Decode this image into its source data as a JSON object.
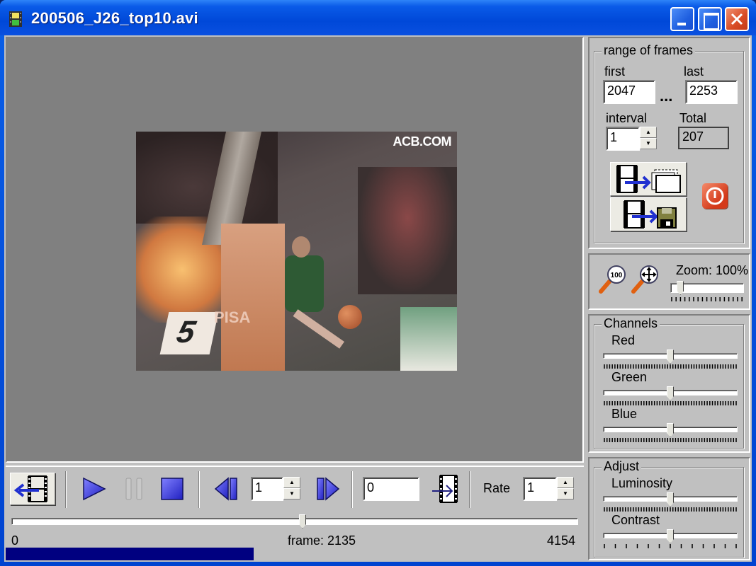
{
  "window": {
    "title": "200506_J26_top10.avi",
    "app_icon": "film-icon",
    "controls": [
      "minimize",
      "maximize",
      "close"
    ]
  },
  "video": {
    "watermark": "ACB.COM",
    "overlay_number": "5",
    "sponsor_text": "PISA"
  },
  "playback": {
    "back_button": "film-back-icon",
    "play": "play-icon",
    "pause": "pause-icon",
    "stop": "stop-icon",
    "prev_frame": "step-back-icon",
    "step_value": "1",
    "next_frame": "step-forward-icon",
    "goto_frame_value": "0",
    "goto_button": "goto-frame-icon",
    "rate_label": "Rate",
    "rate_value": "1"
  },
  "timeline": {
    "min_label": "0",
    "max_label": "4154",
    "frame_label": "frame: 2135",
    "current_frame": 2135,
    "total_frames": 4154,
    "progress_fraction": 0.43
  },
  "range": {
    "legend": "range of frames",
    "first_label": "first",
    "first_value": "2047",
    "last_label": "last",
    "last_value": "2253",
    "separator": "...",
    "interval_label": "interval",
    "interval_value": "1",
    "total_label": "Total",
    "total_value": "207",
    "extract_frames_button": "film-to-frames-icon",
    "save_button": "film-to-disk-icon",
    "stop_button": "power-icon"
  },
  "zoom": {
    "label": "Zoom: 100%",
    "zoom100_icon": "magnifier-100-icon",
    "pan_icon": "magnifier-move-icon",
    "value_fraction": 0.1
  },
  "channels": {
    "legend": "Channels",
    "sliders": [
      {
        "label": "Red",
        "value_fraction": 0.5
      },
      {
        "label": "Green",
        "value_fraction": 0.5
      },
      {
        "label": "Blue",
        "value_fraction": 0.5
      }
    ]
  },
  "adjust": {
    "legend": "Adjust",
    "sliders": [
      {
        "label": "Luminosity",
        "value_fraction": 0.5
      },
      {
        "label": "Contrast",
        "value_fraction": 0.5
      }
    ]
  }
}
